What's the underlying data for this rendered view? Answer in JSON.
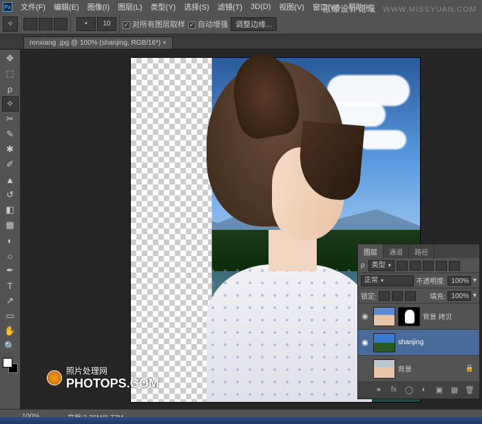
{
  "menu": {
    "file": "文件(F)",
    "edit": "编辑(E)",
    "image": "图像(I)",
    "layer": "图层(L)",
    "type": "类型(Y)",
    "select": "选择(S)",
    "filter": "滤镜(T)",
    "threed": "3D(D)",
    "view": "视图(V)",
    "window": "窗口(W)",
    "help": "帮助(H)"
  },
  "brand": {
    "name": "思缘设计论坛",
    "url": "WWW.MISSYUAN.COM"
  },
  "options": {
    "dot_size_label": "•",
    "dot_size": "10",
    "sample_all": "对所有图层取样",
    "auto_enhance": "自动增强",
    "refine_edge": "调整边缘..."
  },
  "doc": {
    "tab": "renxiang .jpg @ 100% (shanjing, RGB/16*) ×"
  },
  "panels": {
    "tabs": {
      "layers": "图层",
      "channels": "通道",
      "paths": "路径"
    },
    "kind_label": "类型",
    "blend": "正常",
    "opacity_label": "不透明度:",
    "opacity": "100%",
    "lock_label": "锁定:",
    "fill_label": "填充:",
    "fill": "100%",
    "layer0": "背景 拷贝",
    "layer1": "shanjing",
    "layer2": "背景"
  },
  "status": {
    "zoom": "100%",
    "doc_label": "文档:",
    "docinfo": "2.39M/8.77M"
  },
  "watermark": {
    "label": "照片处理网",
    "url": "PHOTOPS.COM"
  },
  "icons": {
    "move": "✥",
    "marquee": "⬚",
    "lasso": "ρ",
    "wand": "✧",
    "crop": "✂",
    "eyedrop": "✎",
    "heal": "✱",
    "brush": "✐",
    "stamp": "▲",
    "history": "↺",
    "eraser": "◧",
    "gradient": "▦",
    "blur": "◐",
    "dodge": "☼",
    "pen": "✒",
    "type": "T",
    "path": "↗",
    "shape": "▭",
    "hand": "✋",
    "zoom": "🔍",
    "eye": "◉",
    "lock": "🔒",
    "fx": "fx",
    "mask": "◯",
    "adj": "◐",
    "group": "▣",
    "new": "▦",
    "trash": "🗑",
    "link": "⚭",
    "chev": "▾"
  }
}
